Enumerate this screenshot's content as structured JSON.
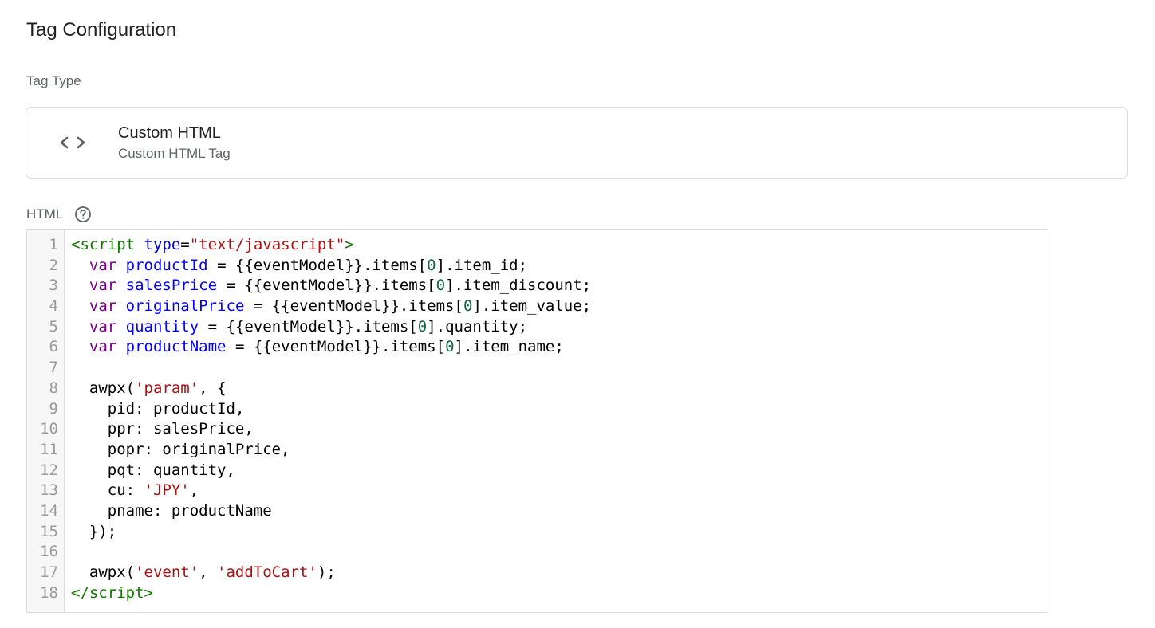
{
  "page": {
    "title": "Tag Configuration"
  },
  "tag_type": {
    "section_label": "Tag Type",
    "icon": "code-brackets-icon",
    "name": "Custom HTML",
    "subtitle": "Custom HTML Tag"
  },
  "html_section": {
    "label": "HTML",
    "help_icon": "help-circle-icon"
  },
  "colors": {
    "tag": "#117700",
    "attribute": "#0000cc",
    "string": "#aa1111",
    "keyword": "#770088",
    "variable_def": "#0000ff",
    "number": "#116644"
  },
  "code_editor": {
    "lines": [
      {
        "number": "1",
        "tokens": [
          {
            "t": "tag",
            "v": "<script"
          },
          {
            "t": "plain",
            "v": " "
          },
          {
            "t": "attr",
            "v": "type"
          },
          {
            "t": "plain",
            "v": "="
          },
          {
            "t": "str",
            "v": "\"text/javascript\""
          },
          {
            "t": "tag",
            "v": ">"
          }
        ]
      },
      {
        "number": "2",
        "tokens": [
          {
            "t": "plain",
            "v": "  "
          },
          {
            "t": "kw",
            "v": "var"
          },
          {
            "t": "plain",
            "v": " "
          },
          {
            "t": "def",
            "v": "productId"
          },
          {
            "t": "plain",
            "v": " = {{eventModel}}.items["
          },
          {
            "t": "num",
            "v": "0"
          },
          {
            "t": "plain",
            "v": "].item_id;"
          }
        ]
      },
      {
        "number": "3",
        "tokens": [
          {
            "t": "plain",
            "v": "  "
          },
          {
            "t": "kw",
            "v": "var"
          },
          {
            "t": "plain",
            "v": " "
          },
          {
            "t": "def",
            "v": "salesPrice"
          },
          {
            "t": "plain",
            "v": " = {{eventModel}}.items["
          },
          {
            "t": "num",
            "v": "0"
          },
          {
            "t": "plain",
            "v": "].item_discount;"
          }
        ]
      },
      {
        "number": "4",
        "tokens": [
          {
            "t": "plain",
            "v": "  "
          },
          {
            "t": "kw",
            "v": "var"
          },
          {
            "t": "plain",
            "v": " "
          },
          {
            "t": "def",
            "v": "originalPrice"
          },
          {
            "t": "plain",
            "v": " = {{eventModel}}.items["
          },
          {
            "t": "num",
            "v": "0"
          },
          {
            "t": "plain",
            "v": "].item_value;"
          }
        ]
      },
      {
        "number": "5",
        "tokens": [
          {
            "t": "plain",
            "v": "  "
          },
          {
            "t": "kw",
            "v": "var"
          },
          {
            "t": "plain",
            "v": " "
          },
          {
            "t": "def",
            "v": "quantity"
          },
          {
            "t": "plain",
            "v": " = {{eventModel}}.items["
          },
          {
            "t": "num",
            "v": "0"
          },
          {
            "t": "plain",
            "v": "].quantity;"
          }
        ]
      },
      {
        "number": "6",
        "tokens": [
          {
            "t": "plain",
            "v": "  "
          },
          {
            "t": "kw",
            "v": "var"
          },
          {
            "t": "plain",
            "v": " "
          },
          {
            "t": "def",
            "v": "productName"
          },
          {
            "t": "plain",
            "v": " = {{eventModel}}.items["
          },
          {
            "t": "num",
            "v": "0"
          },
          {
            "t": "plain",
            "v": "].item_name;"
          }
        ]
      },
      {
        "number": "7",
        "tokens": []
      },
      {
        "number": "8",
        "tokens": [
          {
            "t": "plain",
            "v": "  awpx("
          },
          {
            "t": "str",
            "v": "'param'"
          },
          {
            "t": "plain",
            "v": ", {"
          }
        ]
      },
      {
        "number": "9",
        "tokens": [
          {
            "t": "plain",
            "v": "    pid: productId,"
          }
        ]
      },
      {
        "number": "10",
        "tokens": [
          {
            "t": "plain",
            "v": "    ppr: salesPrice,"
          }
        ]
      },
      {
        "number": "11",
        "tokens": [
          {
            "t": "plain",
            "v": "    popr: originalPrice,"
          }
        ]
      },
      {
        "number": "12",
        "tokens": [
          {
            "t": "plain",
            "v": "    pqt: quantity,"
          }
        ]
      },
      {
        "number": "13",
        "tokens": [
          {
            "t": "plain",
            "v": "    cu: "
          },
          {
            "t": "str",
            "v": "'JPY'"
          },
          {
            "t": "plain",
            "v": ","
          }
        ]
      },
      {
        "number": "14",
        "tokens": [
          {
            "t": "plain",
            "v": "    pname: productName"
          }
        ]
      },
      {
        "number": "15",
        "tokens": [
          {
            "t": "plain",
            "v": "  });"
          }
        ]
      },
      {
        "number": "16",
        "tokens": []
      },
      {
        "number": "17",
        "tokens": [
          {
            "t": "plain",
            "v": "  awpx("
          },
          {
            "t": "str",
            "v": "'event'"
          },
          {
            "t": "plain",
            "v": ", "
          },
          {
            "t": "str",
            "v": "'addToCart'"
          },
          {
            "t": "plain",
            "v": ");"
          }
        ]
      },
      {
        "number": "18",
        "tokens": [
          {
            "t": "tag",
            "v": "</script"
          },
          {
            "t": "tag",
            "v": ">"
          }
        ]
      }
    ]
  }
}
